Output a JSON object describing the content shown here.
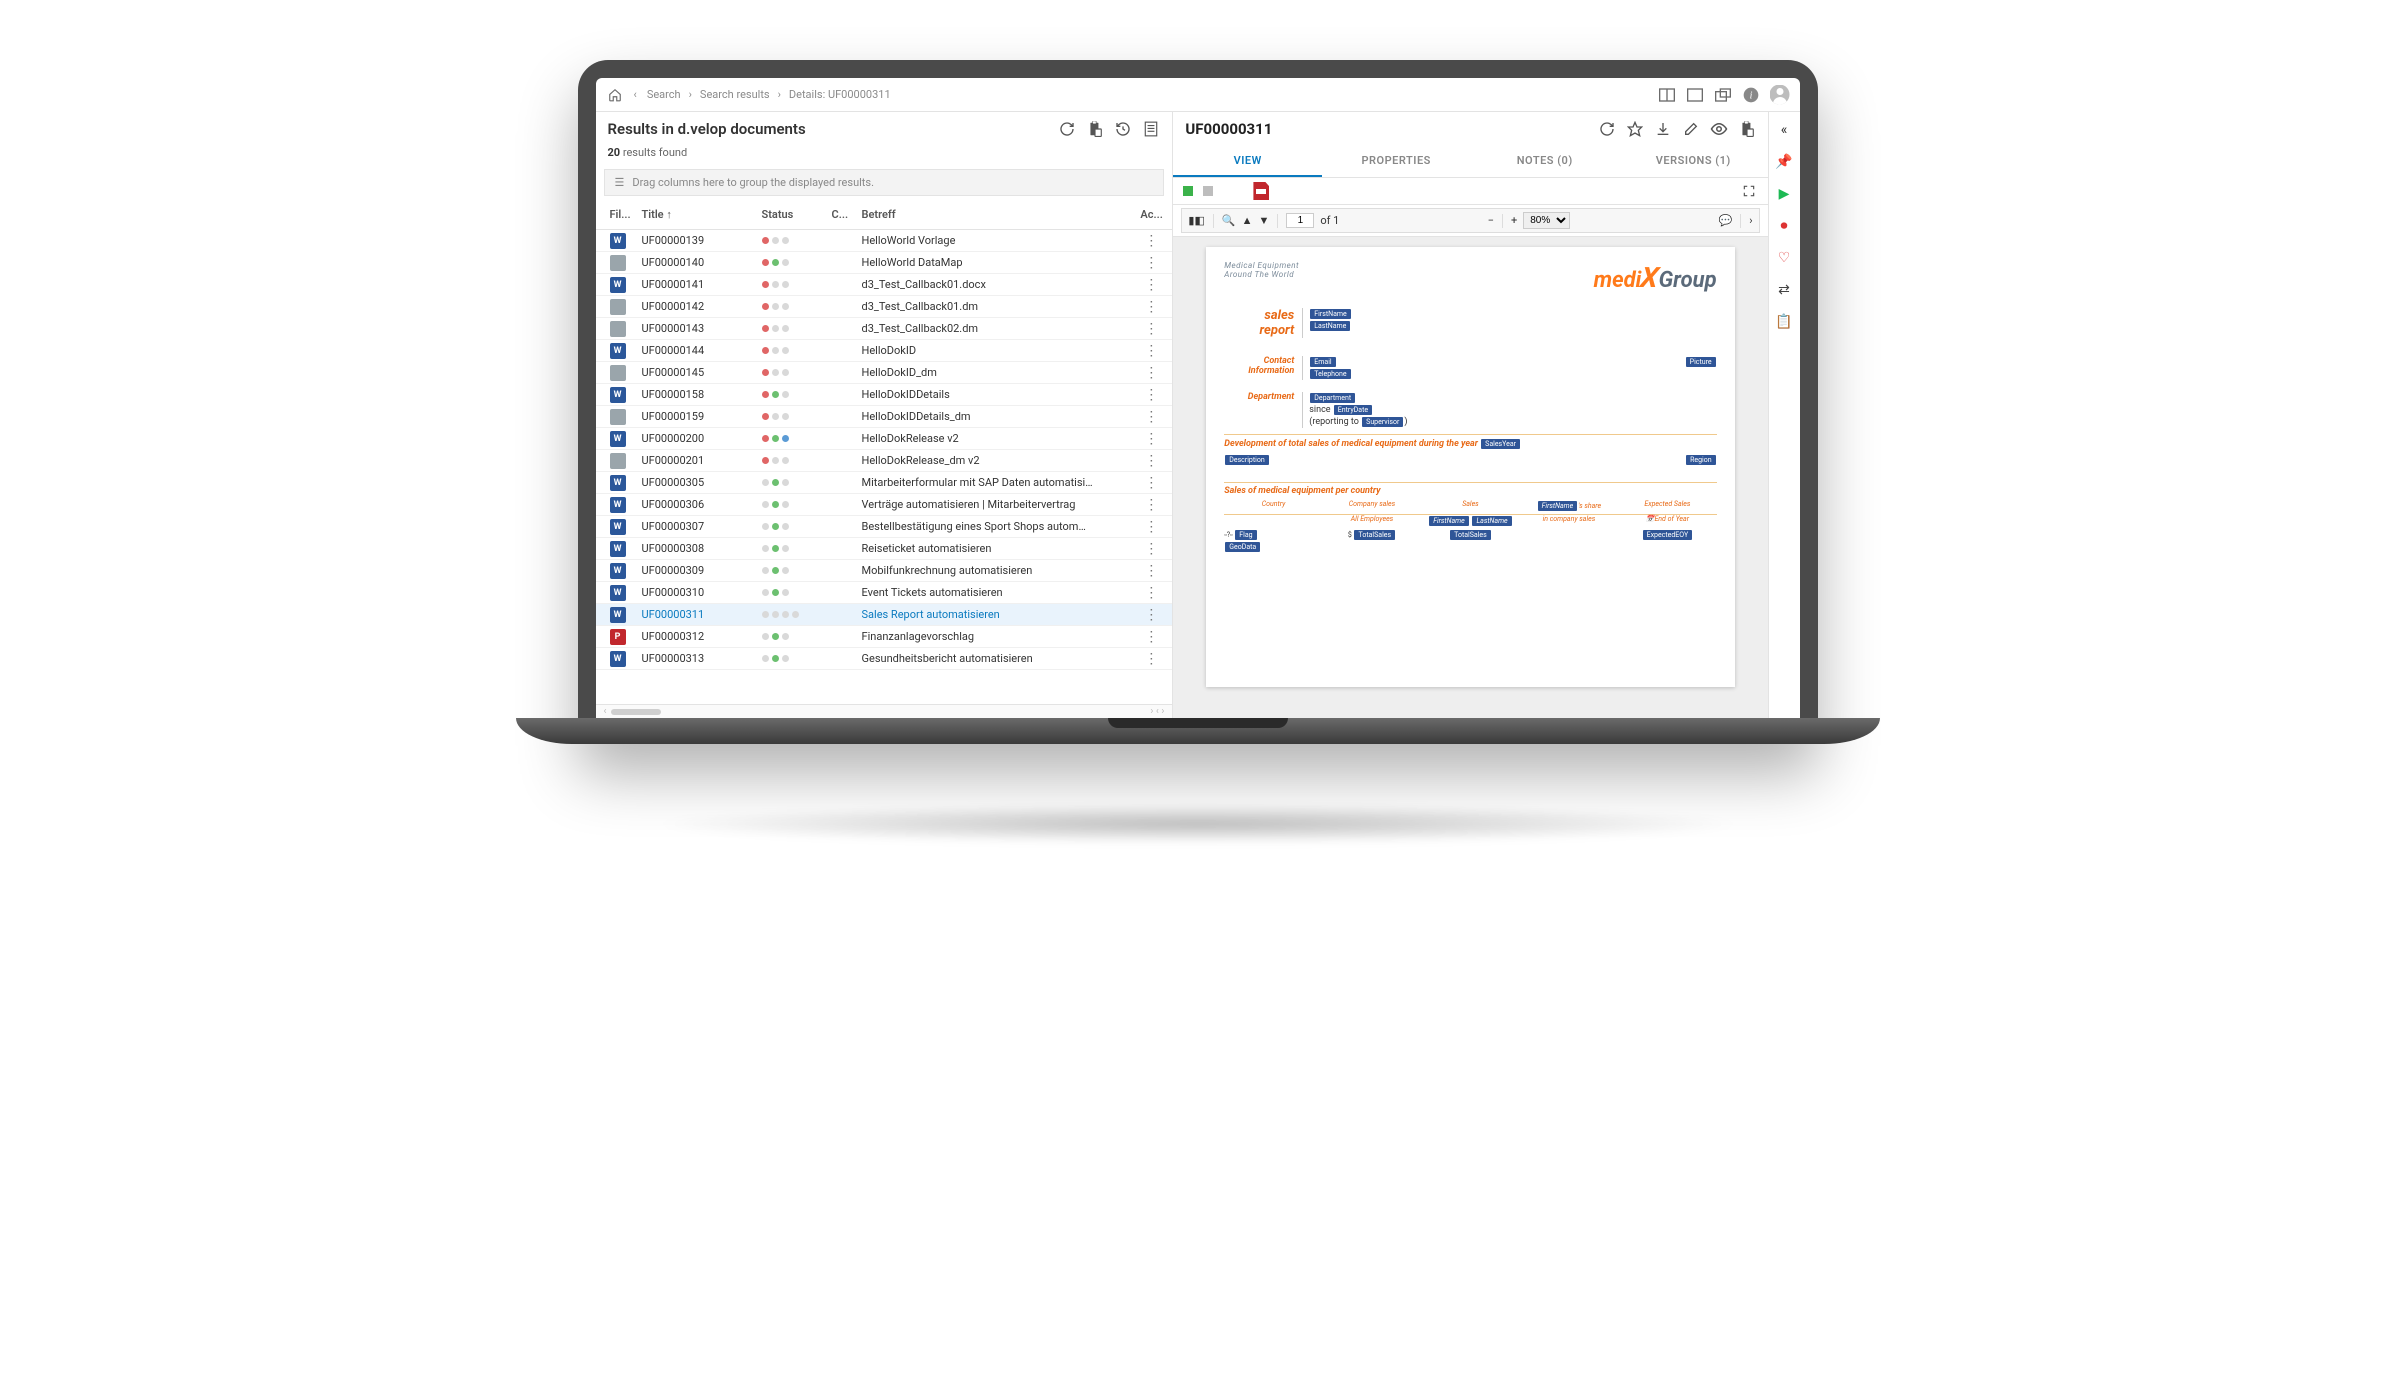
{
  "breadcrumbs": {
    "home": "Search",
    "mid": "Search results",
    "leaf": "Details: UF00000311"
  },
  "topbar_icons": [
    "layout-a",
    "layout-b",
    "layout-copy",
    "info",
    "user"
  ],
  "results": {
    "title": "Results in d.velop documents",
    "count_num": "20",
    "count_label": " results found",
    "group_hint": "Drag columns here to group the displayed results.",
    "columns": {
      "file": "Fil...",
      "title": "Title ↑",
      "status": "Status",
      "c": "C...",
      "betreff": "Betreff",
      "ac": "Ac..."
    },
    "rows": [
      {
        "id": "UF00000139",
        "ft": "word",
        "betreff": "HelloWorld Vorlage",
        "dots": [
          "r",
          "",
          ""
        ]
      },
      {
        "id": "UF00000140",
        "ft": "generic",
        "betreff": "HelloWorld DataMap",
        "dots": [
          "r",
          "g",
          ""
        ]
      },
      {
        "id": "UF00000141",
        "ft": "word",
        "betreff": "d3_Test_Callback01.docx",
        "dots": [
          "r",
          "",
          ""
        ]
      },
      {
        "id": "UF00000142",
        "ft": "generic",
        "betreff": "d3_Test_Callback01.dm",
        "dots": [
          "r",
          "",
          ""
        ]
      },
      {
        "id": "UF00000143",
        "ft": "generic",
        "betreff": "d3_Test_Callback02.dm",
        "dots": [
          "r",
          "",
          ""
        ]
      },
      {
        "id": "UF00000144",
        "ft": "word",
        "betreff": "HelloDokID",
        "dots": [
          "r",
          "",
          ""
        ]
      },
      {
        "id": "UF00000145",
        "ft": "generic",
        "betreff": "HelloDokID_dm",
        "dots": [
          "r",
          "",
          ""
        ]
      },
      {
        "id": "UF00000158",
        "ft": "word",
        "betreff": "HelloDokIDDetails",
        "dots": [
          "r",
          "g",
          ""
        ]
      },
      {
        "id": "UF00000159",
        "ft": "generic",
        "betreff": "HelloDokIDDetails_dm",
        "dots": [
          "r",
          "",
          ""
        ]
      },
      {
        "id": "UF00000200",
        "ft": "word",
        "betreff": "HelloDokRelease v2",
        "dots": [
          "r",
          "g",
          "b"
        ]
      },
      {
        "id": "UF00000201",
        "ft": "generic",
        "betreff": "HelloDokRelease_dm v2",
        "dots": [
          "r",
          "",
          ""
        ]
      },
      {
        "id": "UF00000305",
        "ft": "word",
        "betreff": "Mitarbeiterformular mit SAP Daten automatisi…",
        "dots": [
          "",
          "g",
          ""
        ]
      },
      {
        "id": "UF00000306",
        "ft": "word",
        "betreff": "Verträge automatisieren | Mitarbeitervertrag",
        "dots": [
          "",
          "g",
          ""
        ]
      },
      {
        "id": "UF00000307",
        "ft": "word",
        "betreff": "Bestellbestätigung eines Sport Shops autom…",
        "dots": [
          "",
          "g",
          ""
        ]
      },
      {
        "id": "UF00000308",
        "ft": "word",
        "betreff": "Reiseticket automatisieren",
        "dots": [
          "",
          "g",
          ""
        ]
      },
      {
        "id": "UF00000309",
        "ft": "word",
        "betreff": "Mobilfunkrechnung automatisieren",
        "dots": [
          "",
          "g",
          ""
        ]
      },
      {
        "id": "UF00000310",
        "ft": "word",
        "betreff": "Event Tickets automatisieren",
        "dots": [
          "",
          "g",
          ""
        ]
      },
      {
        "id": "UF00000311",
        "ft": "word",
        "betreff": "Sales Report automatisieren",
        "dots": [
          "",
          "",
          "",
          ""
        ],
        "sel": true
      },
      {
        "id": "UF00000312",
        "ft": "pdf",
        "betreff": "Finanzanlagevorschlag",
        "dots": [
          "",
          "g",
          ""
        ]
      },
      {
        "id": "UF00000313",
        "ft": "word",
        "betreff": "Gesundheitsbericht automatisieren",
        "dots": [
          "",
          "g",
          ""
        ]
      }
    ]
  },
  "detail": {
    "doc_id": "UF00000311",
    "tabs": {
      "view": "VIEW",
      "props": "PROPERTIES",
      "notes": "NOTES (0)",
      "versions": "VERSIONS (1)"
    },
    "pdf": {
      "page_input": "1",
      "page_of": "of 1",
      "zoom": "80%"
    },
    "preview": {
      "tag1": "Medical Equipment",
      "tag2": "Around The World",
      "logo_a": "medi",
      "logo_b": "Group",
      "sales": "sales",
      "report": "report",
      "first": "FirstName",
      "last": "LastName",
      "contact": "Contact",
      "info": "Information",
      "email": "Email",
      "tel": "Telephone",
      "pic": "Picture",
      "dept": "Department",
      "dept_chip": "Department",
      "since": "since",
      "entry": "EntryDate",
      "reporting": "(reporting to ",
      "sup": "Supervisor",
      "paren": ")",
      "h1": "Development of total sales of medical equipment during the year",
      "sy": "SalesYear",
      "desc": "Description",
      "region": "Region",
      "h2": "Sales of medical equipment per country",
      "th": {
        "country": "Country",
        "cs": "Company sales",
        "sales": "Sales",
        "share": "'s share",
        "exp": "Expected Sales"
      },
      "sub1": "All Employees",
      "sub2": "in company sales",
      "eoy": "End of Year",
      "flag": "Flag",
      "gd": "GeoData",
      "ts": "TotalSales",
      "ts2": "TotalSales",
      "ey": "ExpectedEOY",
      "fn": "FirstName",
      "ln": "LastName"
    }
  }
}
